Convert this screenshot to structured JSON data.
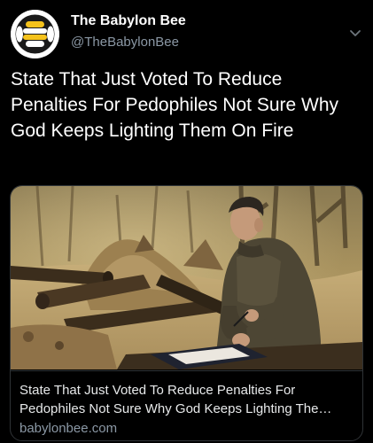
{
  "tweet": {
    "author_name": "The Babylon Bee",
    "author_handle": "@TheBabylonBee",
    "avatar_icon": "babylon-bee-logo-icon",
    "more_icon": "chevron-down-icon",
    "text": "State That Just Voted To Reduce Penalties For Pedophiles Not Sure Why God Keeps Lighting Them On Fire"
  },
  "card": {
    "image_alt": "man-signing-paper-in-burned-forest-image",
    "title_line1": "State That Just Voted To Reduce Penalties For",
    "title_line2": "Pedophiles Not Sure Why God Keeps Lighting The…",
    "domain": "babylonbee.com"
  },
  "colors": {
    "background": "#000000",
    "text_primary": "#ffffff",
    "text_secondary": "#8b98a5",
    "card_border": "#2f3336",
    "avatar_bg": "#ffffff",
    "logo_dark": "#1a1a1a",
    "logo_yellow": "#f5c21b"
  }
}
